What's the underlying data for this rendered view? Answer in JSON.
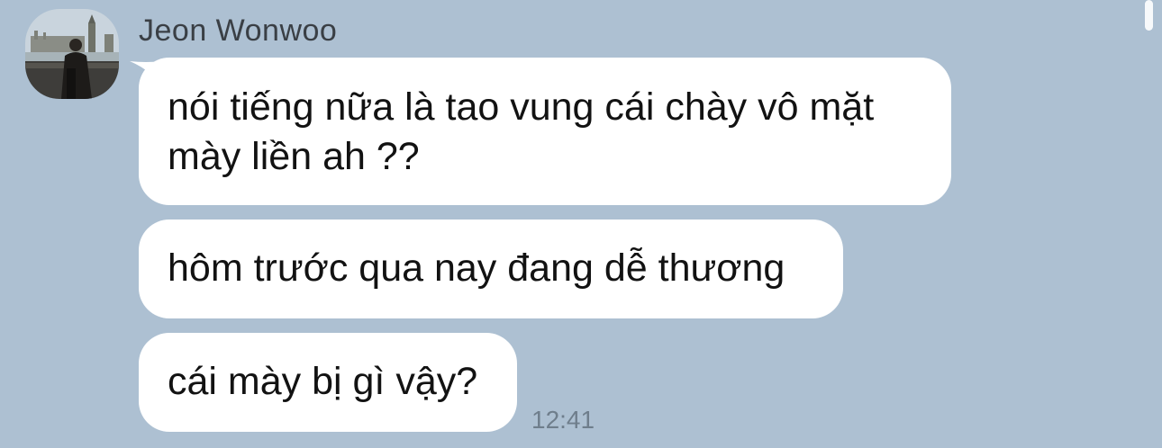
{
  "chat": {
    "sender_name": "Jeon Wonwoo",
    "messages": [
      {
        "text": "nói tiếng nữa là tao vung cái chày vô mặt\nmày liền ah ??"
      },
      {
        "text": "hôm trước qua nay đang dễ thương"
      },
      {
        "text": "cái mày bị gì vậy?"
      }
    ],
    "timestamp": "12:41"
  },
  "colors": {
    "background": "#adc0d2",
    "bubble": "#ffffff",
    "sender_name": "#3a3f45",
    "timestamp": "#6f7e8c"
  },
  "icons": {
    "avatar": "profile-photo-london-icon"
  }
}
